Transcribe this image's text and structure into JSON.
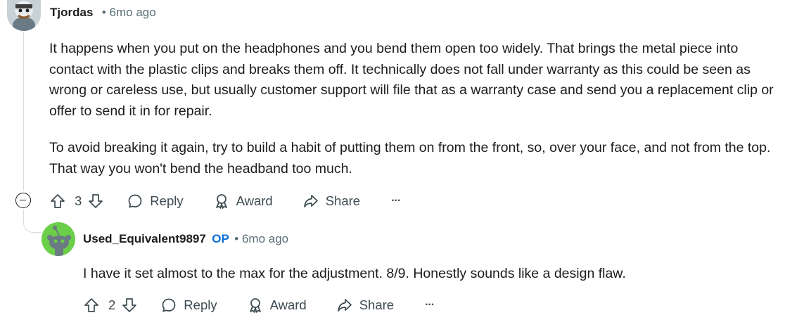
{
  "comments": [
    {
      "username": "Tjordas",
      "time": "• 6mo ago",
      "paragraphs": [
        "It happens when you put on the headphones and you bend them open too widely. That brings the metal piece into contact with the plastic clips and breaks them off. It technically does not fall under warranty as this could be seen as wrong or careless use, but usually customer support will file that as a warranty case and send you a replacement clip or offer to send it in for repair.",
        "To avoid breaking it again, try to build a habit of putting them on from the front, so, over your face, and not from the top. That way you won't bend the headband too much."
      ],
      "score": "3",
      "actions": {
        "reply": "Reply",
        "award": "Award",
        "share": "Share",
        "more": "···"
      }
    },
    {
      "username": "Used_Equivalent9897",
      "badge": "OP",
      "time": "• 6mo ago",
      "paragraphs": [
        "I have it set almost to the max for the adjustment. 8/9. Honestly sounds like a design flaw."
      ],
      "score": "2",
      "actions": {
        "reply": "Reply",
        "award": "Award",
        "share": "Share",
        "more": "···"
      }
    }
  ],
  "icons": {
    "upvote": "arrow-up-outline-icon",
    "downvote": "arrow-down-outline-icon",
    "reply": "speech-bubble-icon",
    "award": "award-ribbon-icon",
    "share": "share-arrow-icon",
    "more": "ellipsis-icon",
    "collapse": "minus-circle-icon"
  },
  "colors": {
    "op_badge": "#0a6fd6",
    "meta_text": "#576f76",
    "thread_line": "#d8dcdf",
    "avatar2_bg": "#6bcf4a"
  }
}
